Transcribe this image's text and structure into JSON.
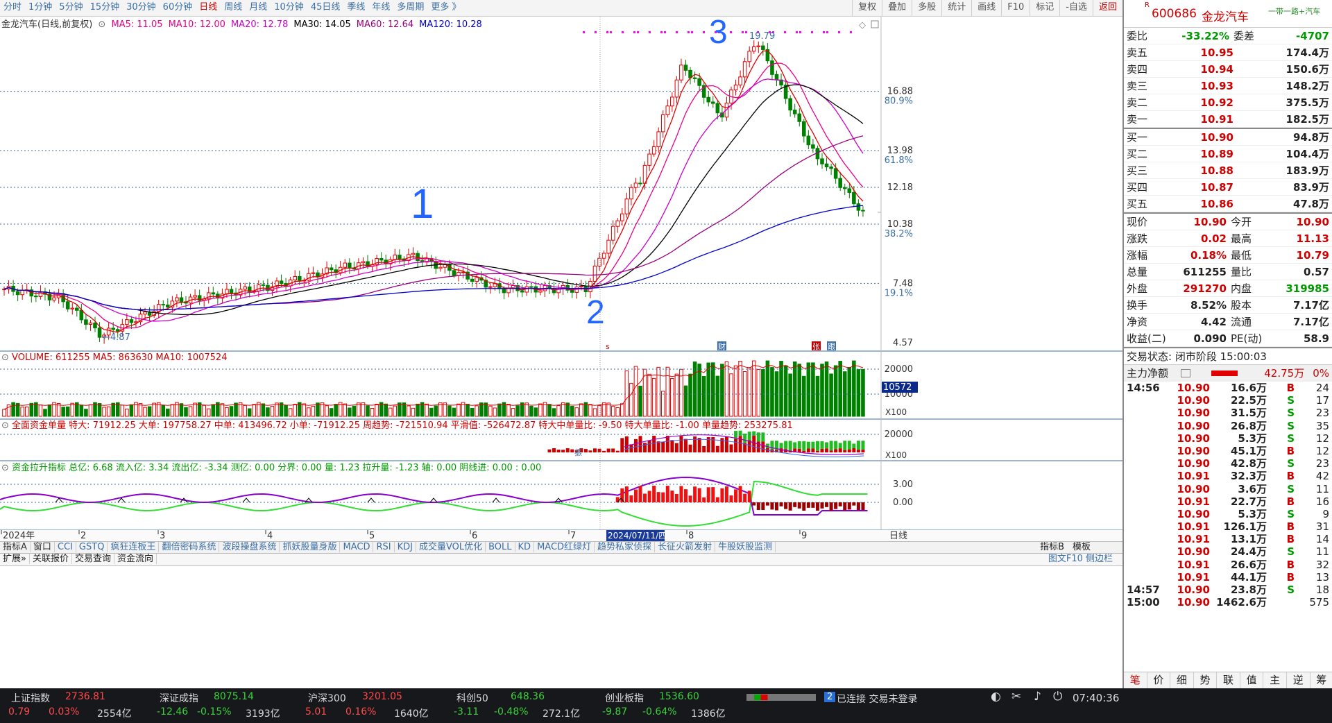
{
  "topbar": {
    "periods": [
      "分时",
      "1分钟",
      "5分钟",
      "15分钟",
      "30分钟",
      "60分钟",
      "日线",
      "周线",
      "月线",
      "10分钟",
      "45日线",
      "季线",
      "年线",
      "多周期",
      "更多 》"
    ],
    "active_period": "日线",
    "right_tools": [
      "复权",
      "叠加",
      "多股",
      "统计",
      "画线",
      "F10",
      "标记",
      "-自选",
      "返回"
    ]
  },
  "chart": {
    "title": "金龙汽车(日线,前复权)",
    "ma_labels": [
      {
        "text": "MA5: 11.05",
        "color": "#e8008a"
      },
      {
        "text": "MA10: 12.00",
        "color": "#e8008a"
      },
      {
        "text": "MA20: 12.78",
        "color": "#cc00cc"
      },
      {
        "text": "MA30: 14.05",
        "color": "#000000"
      },
      {
        "text": "MA60: 12.64",
        "color": "#9a0080"
      },
      {
        "text": "MA120: 10.28",
        "color": "#0000cc"
      }
    ],
    "y_ticks": [
      "16.88",
      "13.98",
      "12.18",
      "10.38",
      "7.48",
      "4.57"
    ],
    "pct_ticks": [
      "80.9%",
      "61.8%",
      "38.2%",
      "19.1%"
    ],
    "high_label": "19.79",
    "low_label": "4.87",
    "annotations": [
      "1",
      "2",
      "3"
    ],
    "markers": [
      "s",
      "财",
      "张",
      "跟"
    ]
  },
  "volume": {
    "label": "VOLUME: 611255  MA5: 863630  MA10: 1007524",
    "ticks": [
      "20000",
      "10000"
    ],
    "current_box": "10572",
    "unit": "X100"
  },
  "fund": {
    "label": "全面资金单量 特大: 71912.25  大单: 197758.27  中单: 413496.72  小单: -71912.25  周趋势: -721510.94  平滑值: -526472.87  特大中单量比: -9.50  特大单量比: -1.00  单量趋势: 253275.81",
    "ticks": [
      "20000"
    ],
    "unit": "X100",
    "mark": "振"
  },
  "lift": {
    "label": "资金拉升指标 总亿: 6.68  流入亿: 3.34  流出亿: -3.34  测亿: 0.00  分界: 0.00  量: 1.23  拉升量: -1.23  轴: 0.00  阴线进: 0.00  : 0.00",
    "ticks": [
      "3.00",
      "0.00"
    ]
  },
  "xaxis": {
    "labels": [
      "2024年",
      "2",
      "3",
      "4",
      "5",
      "6",
      "7",
      "8",
      "9"
    ],
    "cursor_date": "2024/07/11/四",
    "mode": "日线"
  },
  "indicator_tabs": [
    "指标A",
    "窗口",
    "CCI",
    "GSTQ",
    "疯狂连板王",
    "翻倍密码系统",
    "波段操盘系统",
    "抓妖股量身版",
    "MACD",
    "RSI",
    "KDJ",
    "成交量VOL优化",
    "BOLL",
    "KD",
    "MACD红绿灯",
    "趋势私家侦探",
    "长征火箭发射",
    "牛股妖股监测"
  ],
  "indicator_tabs_right": [
    "指标B",
    "模板"
  ],
  "function_tabs": [
    "扩展»",
    "关联报价",
    "交易查询",
    "资金流向"
  ],
  "function_right": "图文F10 侧边栏",
  "quote": {
    "code": "600686",
    "name": "金龙汽车",
    "slogan": "一带一路+汽车",
    "weibi_label": "委比",
    "weibi": "-33.22%",
    "weicha_label": "委差",
    "weicha": "-4707",
    "sells": [
      {
        "label": "卖五",
        "price": "10.95",
        "vol": "174.4万"
      },
      {
        "label": "卖四",
        "price": "10.94",
        "vol": "150.6万"
      },
      {
        "label": "卖三",
        "price": "10.93",
        "vol": "148.2万"
      },
      {
        "label": "卖二",
        "price": "10.92",
        "vol": "375.5万"
      },
      {
        "label": "卖一",
        "price": "10.91",
        "vol": "182.5万"
      }
    ],
    "buys": [
      {
        "label": "买一",
        "price": "10.90",
        "vol": "94.8万"
      },
      {
        "label": "买二",
        "price": "10.89",
        "vol": "104.4万"
      },
      {
        "label": "买三",
        "price": "10.88",
        "vol": "183.9万"
      },
      {
        "label": "买四",
        "price": "10.87",
        "vol": "83.9万"
      },
      {
        "label": "买五",
        "price": "10.86",
        "vol": "47.8万"
      }
    ],
    "stats": [
      {
        "l1": "现价",
        "v1": "10.90",
        "l2": "今开",
        "v2": "10.90"
      },
      {
        "l1": "涨跌",
        "v1": "0.02",
        "l2": "最高",
        "v2": "11.13"
      },
      {
        "l1": "涨幅",
        "v1": "0.18%",
        "l2": "最低",
        "v2": "10.79"
      },
      {
        "l1": "总量",
        "v1": "611255",
        "l2": "量比",
        "v2": "0.57"
      },
      {
        "l1": "外盘",
        "v1": "291270",
        "l2": "内盘",
        "v2": "319985"
      },
      {
        "l1": "换手",
        "v1": "8.52%",
        "l2": "股本",
        "v2": "7.17亿"
      },
      {
        "l1": "净资",
        "v1": "4.42",
        "l2": "流通",
        "v2": "7.17亿"
      },
      {
        "l1": "收益(二)",
        "v1": "0.090",
        "l2": "PE(动)",
        "v2": "58.9"
      }
    ],
    "trade_status": "交易状态: 闭市阶段 15:00:03",
    "main_net_label": "主力净额",
    "main_net": "42.75万",
    "main_net_pct": "0%",
    "ticks": [
      {
        "time": "14:56",
        "price": "10.90",
        "vol": "16.6万",
        "bs": "B",
        "n": "24"
      },
      {
        "time": "",
        "price": "10.90",
        "vol": "22.5万",
        "bs": "S",
        "n": "17"
      },
      {
        "time": "",
        "price": "10.90",
        "vol": "31.5万",
        "bs": "S",
        "n": "23"
      },
      {
        "time": "",
        "price": "10.90",
        "vol": "26.8万",
        "bs": "S",
        "n": "35"
      },
      {
        "time": "",
        "price": "10.90",
        "vol": "5.3万",
        "bs": "S",
        "n": "12"
      },
      {
        "time": "",
        "price": "10.90",
        "vol": "45.1万",
        "bs": "B",
        "n": "12"
      },
      {
        "time": "",
        "price": "10.90",
        "vol": "42.8万",
        "bs": "S",
        "n": "23"
      },
      {
        "time": "",
        "price": "10.91",
        "vol": "32.3万",
        "bs": "B",
        "n": "42"
      },
      {
        "time": "",
        "price": "10.90",
        "vol": "3.6万",
        "bs": "S",
        "n": "11"
      },
      {
        "time": "",
        "price": "10.91",
        "vol": "22.7万",
        "bs": "B",
        "n": "16"
      },
      {
        "time": "",
        "price": "10.90",
        "vol": "5.3万",
        "bs": "S",
        "n": "9"
      },
      {
        "time": "",
        "price": "10.91",
        "vol": "126.1万",
        "bs": "B",
        "n": "31"
      },
      {
        "time": "",
        "price": "10.91",
        "vol": "13.1万",
        "bs": "B",
        "n": "14"
      },
      {
        "time": "",
        "price": "10.90",
        "vol": "24.4万",
        "bs": "S",
        "n": "11"
      },
      {
        "time": "",
        "price": "10.91",
        "vol": "26.6万",
        "bs": "B",
        "n": "32"
      },
      {
        "time": "",
        "price": "10.91",
        "vol": "44.1万",
        "bs": "B",
        "n": "13"
      },
      {
        "time": "14:57",
        "price": "10.90",
        "vol": "23.8万",
        "bs": "S",
        "n": "18"
      },
      {
        "time": "15:00",
        "price": "10.90",
        "vol": "1462.6万",
        "bs": "",
        "n": "575"
      }
    ],
    "bottom_tabs": [
      "笔",
      "价",
      "细",
      "势",
      "联",
      "值",
      "主",
      "逆",
      "筹"
    ]
  },
  "bottombar": {
    "indices": [
      {
        "name": "上证指数",
        "value": "2736.81",
        "chg": "0.79",
        "pct": "0.03%",
        "amt": "2554亿",
        "up": true
      },
      {
        "name": "深证成指",
        "value": "8075.14",
        "chg": "-12.46",
        "pct": "-0.15%",
        "amt": "3193亿",
        "up": false
      },
      {
        "name": "沪深300",
        "value": "3201.05",
        "chg": "5.01",
        "pct": "0.16%",
        "amt": "1640亿",
        "up": true
      },
      {
        "name": "科创50",
        "value": "648.36",
        "chg": "-3.11",
        "pct": "-0.48%",
        "amt": "272.1亿",
        "up": false
      },
      {
        "name": "创业板指",
        "value": "1536.60",
        "chg": "-9.87",
        "pct": "-0.64%",
        "amt": "1386亿",
        "up": false
      }
    ],
    "conn_badge": "2",
    "conn_text": "已连接 交易未登录",
    "time": "07:40:36"
  }
}
